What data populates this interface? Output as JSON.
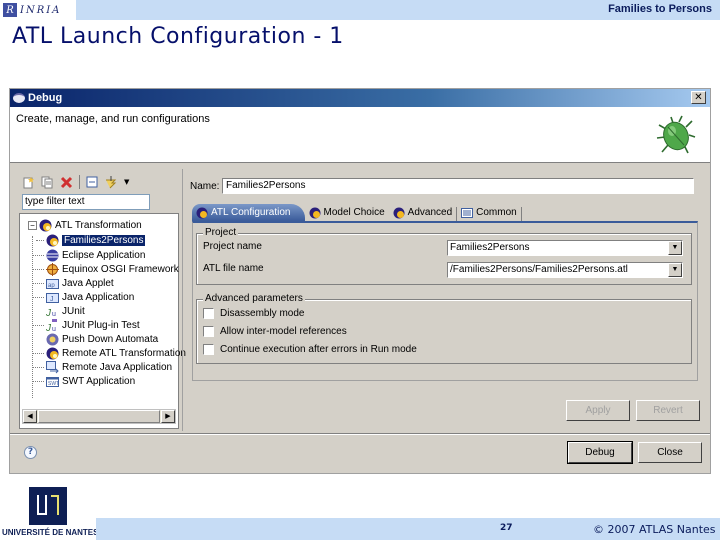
{
  "slide": {
    "org_logo": "INRIA",
    "subject": "Families to Persons",
    "title": "ATL Launch Configuration - 1",
    "page_number": "27",
    "copyright": "© 2007 ATLAS Nantes",
    "university": "UNIVERSITÉ DE NANTES"
  },
  "dialog": {
    "title": "Debug",
    "close_label": "✕",
    "description": "Create, manage, and run configurations",
    "left": {
      "toolbar_icons": [
        "new-config-icon",
        "duplicate-icon",
        "delete-icon",
        "collapse-all-icon",
        "filter-icon",
        "dropdown-arrow-icon"
      ],
      "filter_placeholder": "type filter text",
      "tree": [
        {
          "label": "ATL Transformation",
          "icon": "atl-icon",
          "level": 0,
          "expanded": true
        },
        {
          "label": "Families2Persons",
          "icon": "atl-icon",
          "level": 1,
          "selected": true
        },
        {
          "label": "Eclipse Application",
          "icon": "eclipse-icon",
          "level": 0
        },
        {
          "label": "Equinox OSGI Framework",
          "icon": "osgi-icon",
          "level": 0
        },
        {
          "label": "Java Applet",
          "icon": "applet-icon",
          "level": 0
        },
        {
          "label": "Java Application",
          "icon": "java-app-icon",
          "level": 0
        },
        {
          "label": "JUnit",
          "icon": "junit-icon",
          "level": 0
        },
        {
          "label": "JUnit Plug-in Test",
          "icon": "junit-plugin-icon",
          "level": 0
        },
        {
          "label": "Push Down Automata",
          "icon": "pda-icon",
          "level": 0
        },
        {
          "label": "Remote ATL Transformation",
          "icon": "atl-icon",
          "level": 0
        },
        {
          "label": "Remote Java Application",
          "icon": "remote-java-icon",
          "level": 0
        },
        {
          "label": "SWT Application",
          "icon": "swt-icon",
          "level": 0
        }
      ]
    },
    "right": {
      "name_label": "Name:",
      "name_value": "Families2Persons",
      "tabs": [
        {
          "label": "ATL Configuration",
          "icon": "atl-icon",
          "active": true
        },
        {
          "label": "Model Choice",
          "icon": "atl-icon",
          "active": false
        },
        {
          "label": "Advanced",
          "icon": "atl-icon",
          "active": false
        },
        {
          "label": "Common",
          "icon": "common-icon",
          "active": false
        }
      ],
      "project_group": {
        "title": "Project",
        "project_name_label": "Project name",
        "project_name_value": "Families2Persons",
        "atl_file_label": "ATL file name",
        "atl_file_value": "/Families2Persons/Families2Persons.atl"
      },
      "advanced_group": {
        "title": "Advanced parameters",
        "options": [
          {
            "label": "Disassembly mode",
            "checked": false
          },
          {
            "label": "Allow inter-model references",
            "checked": false
          },
          {
            "label": "Continue execution after errors in Run mode",
            "checked": false
          }
        ]
      },
      "apply_label": "Apply",
      "revert_label": "Revert"
    },
    "debug_label": "Debug",
    "close_button_label": "Close",
    "help_label": "?"
  }
}
